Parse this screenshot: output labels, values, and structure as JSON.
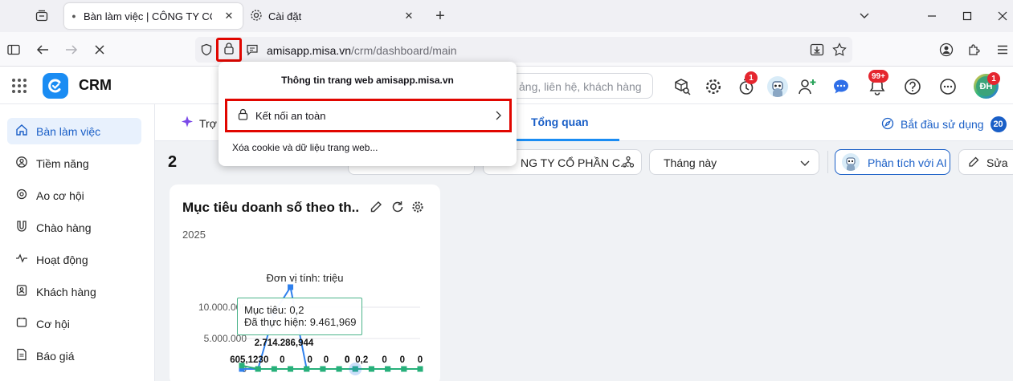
{
  "browser": {
    "tabs": [
      {
        "title": "Bàn làm việc | CÔNG TY CỔ PHẦ",
        "active": true
      },
      {
        "title": "Cài đặt",
        "active": false
      }
    ],
    "new_tab": "+",
    "url": {
      "host": "amisapp.misa.vn",
      "path": "/crm/dashboard/main"
    }
  },
  "site_info_popup": {
    "heading": "Thông tin trang web amisapp.misa.vn",
    "secure_connection": "Kết nối an toàn",
    "clear_cookies": "Xóa cookie và dữ liệu trang web..."
  },
  "app": {
    "brand": "CRM",
    "search_placeholder": "ảng, liên hệ, khách hàng",
    "badges": {
      "timer": "1",
      "notifications": "99+",
      "avatar": "1"
    },
    "avatar_initials": "ĐH",
    "colors": {
      "accent": "#1a8cf3",
      "active_bg": "#e8f1fd",
      "badge": "#e5262f",
      "highlight": "#e10600"
    }
  },
  "sidebar": {
    "items": [
      {
        "label": "Bàn làm việc",
        "icon": "home-icon",
        "active": true
      },
      {
        "label": "Tiềm năng",
        "icon": "target-icon",
        "active": false
      },
      {
        "label": "Ao cơ hội",
        "icon": "pool-icon",
        "active": false
      },
      {
        "label": "Chào hàng",
        "icon": "magnet-icon",
        "active": false
      },
      {
        "label": "Hoạt động",
        "icon": "activity-icon",
        "active": false
      },
      {
        "label": "Khách hàng",
        "icon": "customer-icon",
        "active": false
      },
      {
        "label": "Cơ hội",
        "icon": "opportunity-icon",
        "active": false
      },
      {
        "label": "Báo giá",
        "icon": "quote-icon",
        "active": false
      }
    ]
  },
  "toolbar": {
    "assistant_tab": "Trợ l",
    "overview_tab": "Tổng quan",
    "getting_started": "Bắt đầu sử dụng",
    "getting_started_count": "20",
    "count_label": "2",
    "company_filter": "NG TY CỔ PHẦN C...",
    "period_filter": "Tháng này",
    "ai_button": "Phân tích với AI",
    "edit_button": "Sửa"
  },
  "card": {
    "title": "Mục tiêu doanh số theo th...",
    "year": "2025",
    "unit_label": "Đơn vị tính: triệu",
    "tooltip": {
      "target": "Mục tiêu: 0,2",
      "actual": "Đã thực hiện: 9.461,969"
    }
  },
  "chart_data": {
    "type": "line",
    "yticks": [
      "10.000.000",
      "5.000.000",
      "0"
    ],
    "ylim": [
      0,
      11000000
    ],
    "series": [
      {
        "values": [
          0,
          0,
          10000000,
          2714286944,
          0,
          0,
          0,
          0,
          0,
          0,
          0,
          0
        ]
      },
      {
        "values": [
          605123,
          0,
          0,
          0,
          0,
          0,
          0,
          0.2,
          0,
          0,
          0,
          0
        ]
      }
    ],
    "data_labels": [
      "605,123",
      "0",
      "0",
      "2.714.286,944",
      "0",
      "0",
      "0",
      "0",
      "0,2",
      "0",
      "0",
      "0"
    ]
  }
}
